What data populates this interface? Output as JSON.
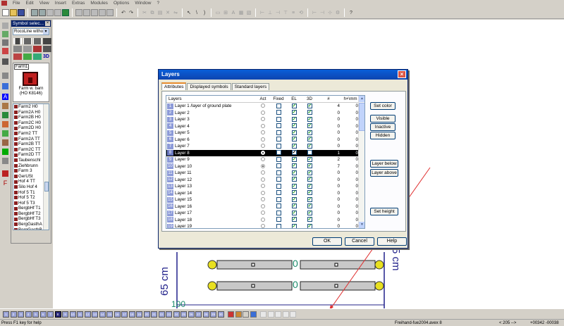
{
  "menu": [
    "File",
    "Edit",
    "View",
    "Insert",
    "Extras",
    "Modules",
    "Options",
    "Window",
    "?"
  ],
  "palette": {
    "title": "Symbol selec...",
    "combo_value": "RocoLine witho",
    "preview_name": "Farm1",
    "preview_desc1": "Farm w. barn",
    "preview_desc2": "(HO K8146)",
    "threed_label": "3D",
    "items": [
      "Farm2 H0",
      "Farm2A H0",
      "Farm2B H0",
      "Farm2C H0",
      "Farm2D H0",
      "Farm2 TT",
      "Farm2A TT",
      "Farm2B TT",
      "Farm2C TT",
      "Farm2D TT",
      "Taubenschl",
      "Ziehbrunn",
      "Farm 3",
      "GerUSt",
      "Hof 4 TT",
      "Silo Hof 4",
      "Hof 5 T1",
      "Hof 5 T2",
      "Hof 5 T3",
      "BergbHf T1",
      "BergbHf T2",
      "BergbHf T3",
      "BergGasthA",
      "BergGasthB",
      "Farm1",
      "Farm2",
      "Farm3",
      "Farm4",
      "Bauernhs5",
      "Bauernhs6",
      "Bauernhs7",
      "Bauernhs8"
    ],
    "selected_index": 24
  },
  "dialog": {
    "title": "Layers",
    "tabs": [
      "Attributes",
      "Displayed symbols",
      "Standard layers"
    ],
    "active_tab": 0,
    "columns": [
      "Layers",
      "Act",
      "Fixed",
      "EL",
      "3D",
      "#",
      "h+\\mm"
    ],
    "rows": [
      {
        "n": "1",
        "name": "Layer 1 /layer of ground plate",
        "count": "4",
        "h": "0"
      },
      {
        "n": "2",
        "name": "Layer 2",
        "count": "0",
        "h": "0"
      },
      {
        "n": "3",
        "name": "Layer 3",
        "count": "0",
        "h": "0"
      },
      {
        "n": "4",
        "name": "Layer 4",
        "count": "0",
        "h": "0"
      },
      {
        "n": "5",
        "name": "Layer 5",
        "count": "0",
        "h": "0"
      },
      {
        "n": "6",
        "name": "Layer 6",
        "count": "0",
        "h": "0"
      },
      {
        "n": "7",
        "name": "Layer 7",
        "count": "0",
        "h": "0"
      },
      {
        "n": "8",
        "name": "Layer 8",
        "count": "1",
        "h": "0"
      },
      {
        "n": "9",
        "name": "Layer 9",
        "count": "2",
        "h": "0"
      },
      {
        "n": "10",
        "name": "Layer 10",
        "count": "7",
        "h": "0"
      },
      {
        "n": "11",
        "name": "Layer 11",
        "count": "0",
        "h": "0"
      },
      {
        "n": "12",
        "name": "Layer 12",
        "count": "0",
        "h": "0"
      },
      {
        "n": "13",
        "name": "Layer 13",
        "count": "0",
        "h": "0"
      },
      {
        "n": "14",
        "name": "Layer 14",
        "count": "0",
        "h": "0"
      },
      {
        "n": "15",
        "name": "Layer 15",
        "count": "0",
        "h": "0"
      },
      {
        "n": "16",
        "name": "Layer 16",
        "count": "0",
        "h": "0"
      },
      {
        "n": "17",
        "name": "Layer 17",
        "count": "0",
        "h": "0"
      },
      {
        "n": "18",
        "name": "Layer 18",
        "count": "0",
        "h": "0"
      },
      {
        "n": "19",
        "name": "Layer 19",
        "count": "0",
        "h": "0"
      }
    ],
    "selected_row": 7,
    "active_row": 9,
    "buttons": {
      "set_color": "Set color",
      "visible": "Visible",
      "inactive": "Inactive",
      "hidden": "Hidden",
      "layer_below": "Layer below",
      "layer_above": "Layer above",
      "set_height": "Set height",
      "ok": "OK",
      "cancel": "Cancel",
      "help": "Help"
    }
  },
  "canvas": {
    "dim_left": "65 cm",
    "dim_right": "5 cm",
    "dim_bottom": "100",
    "zero_labels": [
      "0",
      "0"
    ]
  },
  "layerbar": {
    "buttons": [
      "1",
      "2",
      "3",
      "4",
      "5",
      "6",
      "7",
      "8",
      "9",
      "10",
      "11",
      "12",
      "13",
      "14",
      "15",
      "16",
      "17",
      "18",
      "19",
      "20",
      "21",
      "22",
      "23",
      "24",
      "25",
      "26",
      "27",
      "28",
      "29",
      "30"
    ],
    "highlighted": "8"
  },
  "status": {
    "help": "Press F1 key for help",
    "file": "Freihand-fue2004.avex 8",
    "zoom": "< 205 -->",
    "coords": "+00342 -00038"
  }
}
